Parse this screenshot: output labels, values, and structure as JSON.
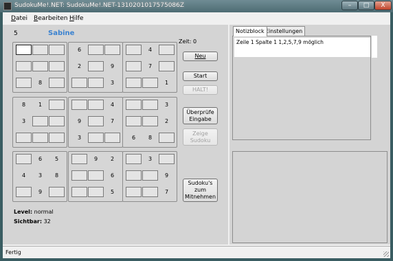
{
  "window": {
    "title": "SudokuMe!.NET: SudokuMe!.NET-1310201017575086Z"
  },
  "titlebar_buttons": {
    "minimize": "–",
    "maximize": "□",
    "close": "X"
  },
  "menu": [
    {
      "hotkey": "D",
      "rest": "atei"
    },
    {
      "hotkey": "B",
      "rest": "earbeiten"
    },
    {
      "hotkey": "H",
      "rest": "ilfe"
    }
  ],
  "header": {
    "puzzle_number": "5",
    "player_name": "Sabine"
  },
  "timer": {
    "label": "Zeit: 0"
  },
  "grid": [
    [
      "",
      "",
      "",
      "6",
      "",
      "",
      "",
      "4",
      ""
    ],
    [
      "",
      "",
      "",
      "2",
      "",
      "9",
      "",
      "7",
      ""
    ],
    [
      "",
      "8",
      "",
      "",
      "",
      "3",
      "",
      "",
      "1"
    ],
    [
      "8",
      "1",
      "",
      "",
      "",
      "4",
      "",
      "",
      "3"
    ],
    [
      "3",
      "",
      "",
      "9",
      "",
      "7",
      "",
      "",
      "2"
    ],
    [
      "",
      "",
      "",
      "3",
      "",
      "",
      "6",
      "8",
      ""
    ],
    [
      "",
      "6",
      "5",
      "",
      "9",
      "2",
      "",
      "3",
      ""
    ],
    [
      "4",
      "3",
      "8",
      "",
      "",
      "6",
      "",
      "",
      "9"
    ],
    [
      "",
      "9",
      "",
      "",
      "",
      "5",
      "",
      "",
      "7"
    ]
  ],
  "selected_cell": {
    "row": 0,
    "col": 0
  },
  "buttons": {
    "neu": "Neu",
    "start": "Start",
    "halt": "HALT!",
    "check": "Überprüfe\nEingabe",
    "show": "Zeige\nSudoku",
    "takeaway": "Sudoku's\nzum\nMitnehmen"
  },
  "info": {
    "level_label": "Level:",
    "level_value": "normal",
    "visible_label": "Sichtbar:",
    "visible_value": "32"
  },
  "tabs": {
    "notes": "Notizblock",
    "settings": "Einstellungen"
  },
  "notes_text": "Zeile 1 Spalte 1 1,2,5,7,9 möglich",
  "status": {
    "text": "Fertig"
  }
}
